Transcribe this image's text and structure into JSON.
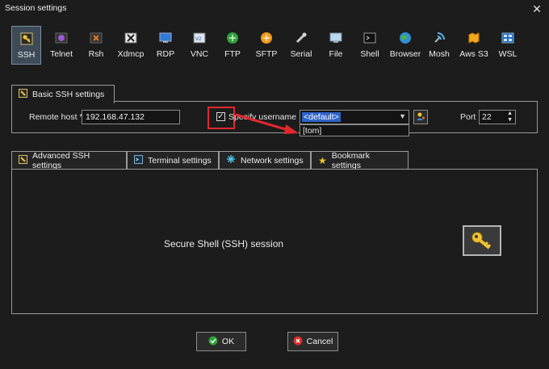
{
  "window": {
    "title": "Session settings",
    "close_glyph": "✕"
  },
  "protocols": [
    {
      "label": "SSH",
      "icon": "ssh-key-icon",
      "selected": true
    },
    {
      "label": "Telnet",
      "icon": "telnet-icon"
    },
    {
      "label": "Rsh",
      "icon": "rsh-icon"
    },
    {
      "label": "Xdmcp",
      "icon": "xdmcp-icon"
    },
    {
      "label": "RDP",
      "icon": "rdp-icon"
    },
    {
      "label": "VNC",
      "icon": "vnc-icon"
    },
    {
      "label": "FTP",
      "icon": "ftp-icon"
    },
    {
      "label": "SFTP",
      "icon": "sftp-icon"
    },
    {
      "label": "Serial",
      "icon": "serial-icon"
    },
    {
      "label": "File",
      "icon": "file-icon"
    },
    {
      "label": "Shell",
      "icon": "shell-icon"
    },
    {
      "label": "Browser",
      "icon": "browser-icon"
    },
    {
      "label": "Mosh",
      "icon": "mosh-icon"
    },
    {
      "label": "Aws S3",
      "icon": "aws-s3-icon"
    },
    {
      "label": "WSL",
      "icon": "wsl-icon"
    }
  ],
  "basic": {
    "tab_label": "Basic SSH settings",
    "remote_host_label": "Remote host *",
    "remote_host_value": "192.168.47.132",
    "specify_username_label": "Specify username",
    "specify_username_checked": true,
    "username_value": "<default>",
    "username_dropdown_option": "[tom]",
    "port_label": "Port",
    "port_value": "22"
  },
  "advanced_tabs": [
    {
      "label": "Advanced SSH settings",
      "icon": "wrench-icon"
    },
    {
      "label": "Terminal settings",
      "icon": "terminal-icon"
    },
    {
      "label": "Network settings",
      "icon": "network-icon"
    },
    {
      "label": "Bookmark settings",
      "icon": "star-icon"
    }
  ],
  "main": {
    "session_text": "Secure Shell (SSH) session"
  },
  "buttons": {
    "ok_label": "OK",
    "cancel_label": "Cancel"
  },
  "colors": {
    "accent": "#3b6fd6",
    "annotation": "#e0282e",
    "selection": "#3e4a57"
  }
}
